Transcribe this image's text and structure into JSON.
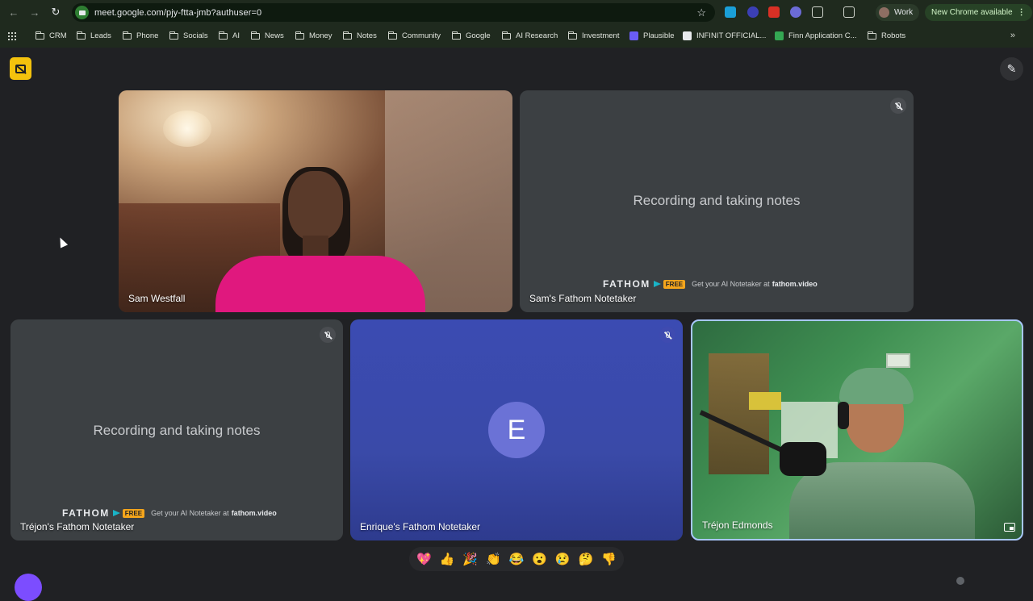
{
  "browser": {
    "url": "meet.google.com/pjy-ftta-jmb?authuser=0",
    "profile_label": "Work",
    "update_label": "New Chrome available",
    "bookmarks": [
      "CRM",
      "Leads",
      "Phone",
      "Socials",
      "AI",
      "News",
      "Money",
      "Notes",
      "Community",
      "Google",
      "AI Research",
      "Investment",
      "Plausible",
      "INFINIT OFFICIAL...",
      "Finn Application C...",
      "Robots"
    ]
  },
  "meet": {
    "tiles": [
      {
        "name": "Sam Westfall"
      },
      {
        "name": "Sam's Fathom Notetaker",
        "message": "Recording and taking notes"
      },
      {
        "name": "Tréjon's Fathom Notetaker",
        "message": "Recording and taking notes"
      },
      {
        "name": "Enrique's Fathom Notetaker",
        "initial": "E"
      },
      {
        "name": "Tréjon Edmonds"
      }
    ],
    "fathom": {
      "brand": "FATHOM",
      "free_badge": "FREE",
      "promo": "Get your AI Notetaker at",
      "site": "fathom.video"
    },
    "reactions": [
      "💖",
      "👍",
      "🎉",
      "👏",
      "😂",
      "😮",
      "😢",
      "🤔",
      "👎"
    ]
  },
  "colors": {
    "meet_background": "#202124",
    "fathom_badge": "#f4c20d",
    "active_speaker_border": "#a8c7fa",
    "enrique_tile": "#3b4bb2"
  }
}
